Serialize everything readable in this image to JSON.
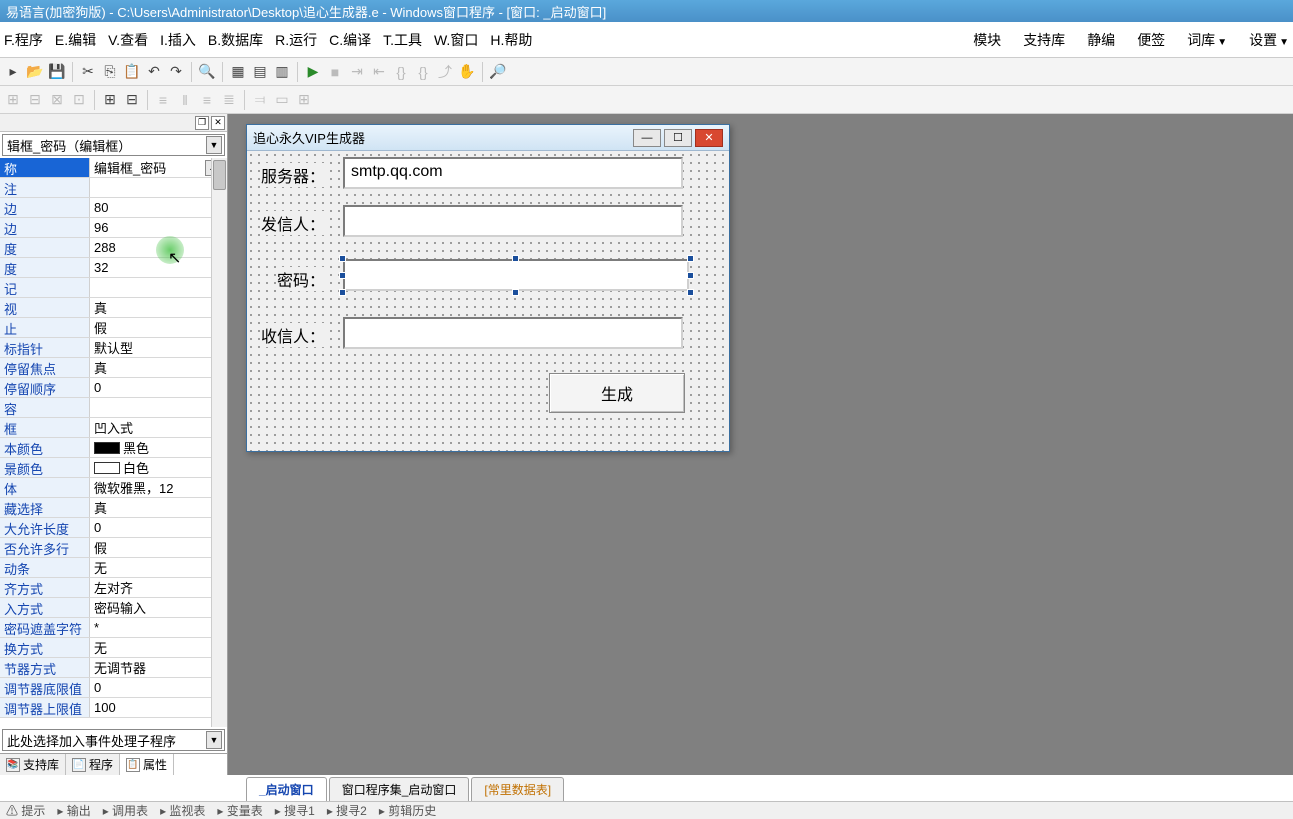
{
  "title": "易语言(加密狗版) - C:\\Users\\Administrator\\Desktop\\追心生成器.e - Windows窗口程序 - [窗口: _启动窗口]",
  "menu": {
    "items": [
      "F.程序",
      "E.编辑",
      "V.查看",
      "I.插入",
      "B.数据库",
      "R.运行",
      "C.编译",
      "T.工具",
      "W.窗口",
      "H.帮助"
    ],
    "right": [
      "模块",
      "支持库",
      "静编",
      "便签",
      "词库",
      "设置"
    ]
  },
  "left_panel": {
    "combo_selected": "辑框_密码（编辑框）",
    "properties": [
      {
        "label": "称",
        "value": "编辑框_密码",
        "selected": true,
        "ellipsis": true
      },
      {
        "label": "注",
        "value": ""
      },
      {
        "label": "边",
        "value": "80"
      },
      {
        "label": "边",
        "value": "96"
      },
      {
        "label": "度",
        "value": "288"
      },
      {
        "label": "度",
        "value": "32"
      },
      {
        "label": "记",
        "value": ""
      },
      {
        "label": "视",
        "value": "真"
      },
      {
        "label": "止",
        "value": "假"
      },
      {
        "label": "标指针",
        "value": "默认型"
      },
      {
        "label": "停留焦点",
        "value": "真"
      },
      {
        "label": "停留顺序",
        "value": "0"
      },
      {
        "label": "容",
        "value": ""
      },
      {
        "label": "框",
        "value": "凹入式"
      },
      {
        "label": "本颜色",
        "value": "黑色",
        "swatch": "black"
      },
      {
        "label": "景颜色",
        "value": "白色",
        "swatch": "white"
      },
      {
        "label": "体",
        "value": "微软雅黑，12"
      },
      {
        "label": "藏选择",
        "value": "真"
      },
      {
        "label": "大允许长度",
        "value": "0"
      },
      {
        "label": "否允许多行",
        "value": "假"
      },
      {
        "label": "动条",
        "value": "无"
      },
      {
        "label": "齐方式",
        "value": "左对齐"
      },
      {
        "label": "入方式",
        "value": "密码输入"
      },
      {
        "label": "密码遮盖字符",
        "value": "*"
      },
      {
        "label": "换方式",
        "value": "无"
      },
      {
        "label": "节器方式",
        "value": "无调节器"
      },
      {
        "label": "调节器底限值",
        "value": "0"
      },
      {
        "label": "调节器上限值",
        "value": "100"
      }
    ],
    "event_combo": "此处选择加入事件处理子程序",
    "bottom_tabs": [
      "支持库",
      "程序",
      "属性"
    ],
    "active_bottom_tab": 2
  },
  "form": {
    "title": "追心永久VIP生成器",
    "labels": {
      "server": "服务器：",
      "sender": "发信人：",
      "password": "密码：",
      "receiver": "收信人："
    },
    "values": {
      "server": "smtp.qq.com",
      "sender": "",
      "password": "",
      "receiver": ""
    },
    "button": "生成"
  },
  "editor_tabs": [
    {
      "label": "_启动窗口",
      "active": true
    },
    {
      "label": "窗口程序集_启动窗口",
      "active": false
    },
    {
      "label": "[常里数据表]",
      "active": false,
      "orange": true
    }
  ],
  "status_items": [
    "提示",
    "输出",
    "调用表",
    "监视表",
    "变量表",
    "搜寻1",
    "搜寻2",
    "剪辑历史"
  ]
}
